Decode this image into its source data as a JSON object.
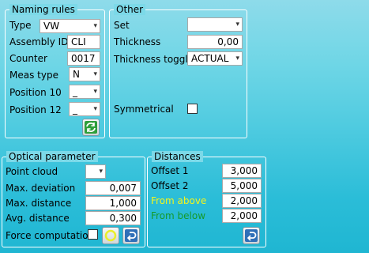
{
  "naming_rules": {
    "title": "Naming rules",
    "type_label": "Type",
    "type_value": "VW",
    "assembly_label": "Assembly ID",
    "assembly_value": "CLI",
    "counter_label": "Counter",
    "counter_value": "0017",
    "meas_label": "Meas type",
    "meas_value": "N",
    "pos10_label": "Position 10",
    "pos10_value": "_",
    "pos12_label": "Position 12",
    "pos12_value": "_"
  },
  "other": {
    "title": "Other",
    "set_label": "Set",
    "set_value": "",
    "thickness_label": "Thickness",
    "thickness_value": "0,00",
    "toggle_label": "Thickness toggle",
    "toggle_value": "ACTUAL",
    "symmetrical_label": "Symmetrical"
  },
  "optical": {
    "title": "Optical parameter",
    "point_cloud_label": "Point cloud",
    "point_cloud_value": "",
    "max_dev_label": "Max. deviation",
    "max_dev_value": "0,007",
    "max_dist_label": "Max. distance",
    "max_dist_value": "1,000",
    "avg_dist_label": "Avg. distance",
    "avg_dist_value": "0,300",
    "force_label": "Force computation"
  },
  "distances": {
    "title": "Distances",
    "offset1_label": "Offset 1",
    "offset1_value": "3,000",
    "offset2_label": "Offset 2",
    "offset2_value": "5,000",
    "from_above_label": "From above",
    "from_above_value": "2,000",
    "from_below_label": "From below",
    "from_below_value": "2,000"
  },
  "colors": {
    "from_above": "#f5f51a",
    "from_below": "#159a2a"
  },
  "icons": {
    "refresh": "refresh-icon",
    "circle": "circle-icon",
    "undo_optical": "undo-icon",
    "undo_distances": "undo-icon",
    "dropdown": "chevron-down-icon"
  }
}
